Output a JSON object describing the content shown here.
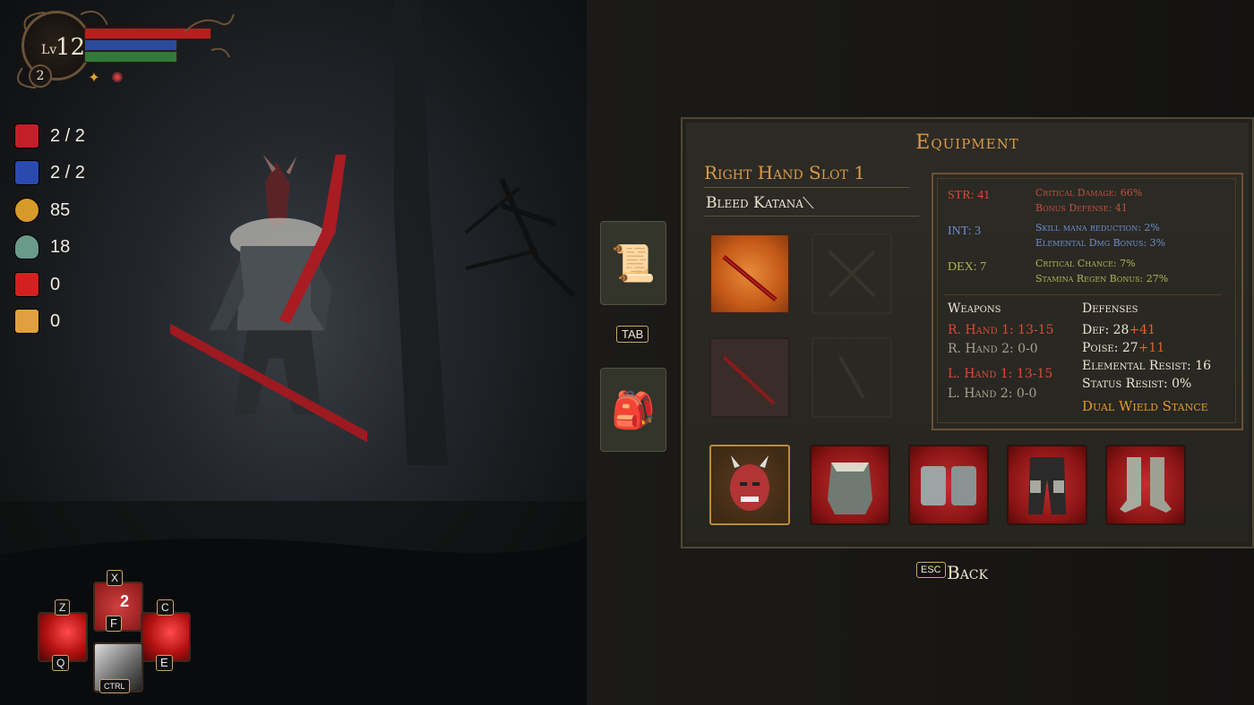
{
  "hud": {
    "level_label": "Lv",
    "level": "12",
    "sub_level": "2",
    "bars": {
      "health": 1.0,
      "mana": 1.0,
      "stamina": 1.0
    },
    "bar_colors": {
      "health": "#b81e1e",
      "mana": "#2b4a9a",
      "stamina": "#2f7a3a"
    }
  },
  "resources": [
    {
      "icon": "health-potion-icon",
      "value": "2 / 2",
      "color": "#c41e2a"
    },
    {
      "icon": "mana-potion-icon",
      "value": "2 / 2",
      "color": "#2a4ab0"
    },
    {
      "icon": "coin-icon",
      "value": "85",
      "color": "#d69a2a"
    },
    {
      "icon": "soul-icon",
      "value": "18",
      "color": "#6a9a8a"
    },
    {
      "icon": "red-gem-icon",
      "value": "0",
      "color": "#d42020"
    },
    {
      "icon": "scroll-icon",
      "value": "0",
      "color": "#e0a040"
    }
  ],
  "skills": {
    "z": {
      "key": "Z",
      "bottom_key": "Q"
    },
    "x": {
      "key": "X",
      "bottom_key": "F",
      "count": "2"
    },
    "c": {
      "key": "C",
      "bottom_key": "E"
    },
    "dash": {
      "bottom_key": "CTRL"
    }
  },
  "side_tabs": {
    "tab_key": "TAB"
  },
  "equipment": {
    "title": "Equipment",
    "slot_title": "Right Hand Slot 1",
    "item_name": "Bleed Katana"
  },
  "stats": {
    "str": {
      "label": "STR: 41",
      "lines": [
        "Critical Damage: 66%",
        "Bonus Defense: 41"
      ]
    },
    "int": {
      "label": "INT: 3",
      "lines": [
        "Skill mana reduction: 2%",
        "Elemental Dmg Bonus: 3%"
      ]
    },
    "dex": {
      "label": "DEX: 7",
      "lines": [
        "Critical Chance: 7%",
        "Stamina Regen Bonus: 27%"
      ]
    }
  },
  "weapons": {
    "heading": "Weapons",
    "r1": "R. Hand 1: 13-15",
    "r2": "R. Hand 2: 0-0",
    "l1": "L. Hand 1: 13-15",
    "l2": "L. Hand 2: 0-0"
  },
  "defenses": {
    "heading": "Defenses",
    "def": "Def: 28",
    "def_bonus": "+41",
    "poise": "Poise: 27",
    "poise_bonus": "+11",
    "elemental": "Elemental Resist: 16",
    "status": "Status Resist: 0%",
    "stance": "Dual Wield Stance"
  },
  "footer": {
    "esc_key": "ESC",
    "back_label": "Back"
  }
}
